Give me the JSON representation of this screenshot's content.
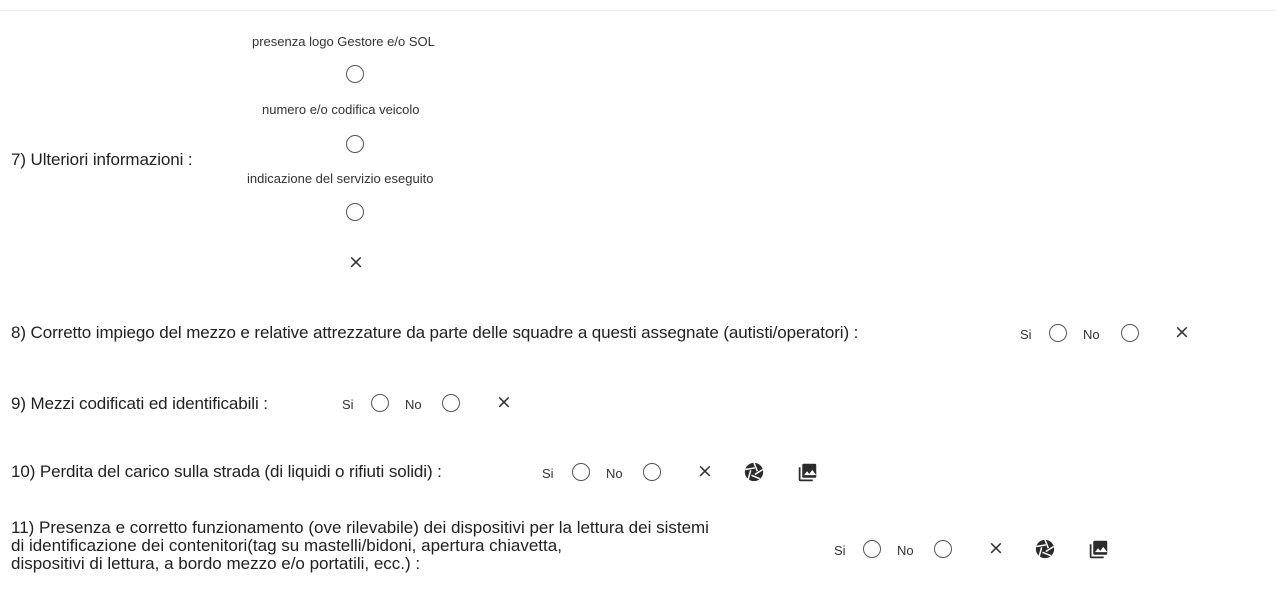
{
  "q7": {
    "label": "7) Ulteriori informazioni :",
    "options": [
      {
        "label": "presenza logo Gestore e/o SOL"
      },
      {
        "label": "numero e/o codifica veicolo"
      },
      {
        "label": "indicazione del servizio eseguito"
      }
    ],
    "clear": "×"
  },
  "q8": {
    "label": "8) Corretto impiego del mezzo e relative attrezzature da parte delle squadre a questi assegnate (autisti/operatori) :",
    "yes": "Si",
    "no": "No",
    "clear": "×"
  },
  "q9": {
    "label": "9) Mezzi codificati ed identificabili :",
    "yes": "Si",
    "no": "No",
    "clear": "×"
  },
  "q10": {
    "label": "10) Perdita del carico sulla strada (di liquidi o rifiuti solidi) :",
    "yes": "Si",
    "no": "No",
    "clear": "×",
    "icons": [
      "camera-aperture-icon",
      "photo-library-icon"
    ]
  },
  "q11": {
    "label": "11) Presenza e corretto funzionamento (ove rilevabile) dei dispositivi per la lettura dei sistemi\ndi identificazione dei contenitori(tag su mastelli/bidoni, apertura chiavetta,\ndispositivi di lettura, a bordo mezzo e/o portatili, ecc.) :",
    "yes": "Si",
    "no": "No",
    "clear": "×",
    "icons": [
      "camera-aperture-icon",
      "photo-library-icon"
    ]
  }
}
